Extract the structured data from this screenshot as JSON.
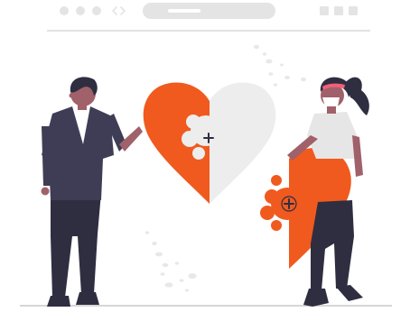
{
  "browser_bar": {
    "icons": [
      "window-dot-icon",
      "window-dot-icon",
      "window-dot-icon",
      "code-brackets-icon",
      "address-bar",
      "window-square-icon",
      "window-square-icon",
      "window-square-icon"
    ]
  },
  "illustration": {
    "subject": "two-people-joining-heart-puzzle",
    "icons": [
      "plus-icon",
      "plus-icon"
    ]
  },
  "colors": {
    "accent": "#f05a1f",
    "heart_light": "#ededed",
    "chrome": "#e4e4e4",
    "dark_clothing": "#2f2e41",
    "skin": "#a0616a",
    "white_top": "#e6e6e6",
    "pink_band": "#f25f7a"
  }
}
